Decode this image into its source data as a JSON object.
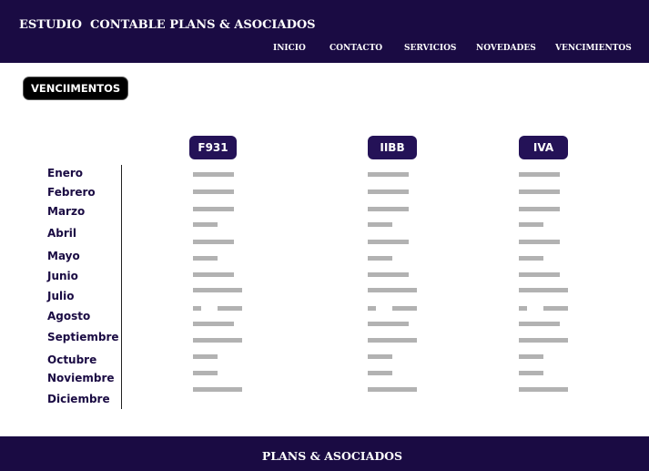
{
  "header": {
    "brand": "ESTUDIO  CONTABLE PLANS & ASOCIADOS",
    "nav": [
      "INICIO",
      "CONTACTO",
      "SERVICIOS",
      "NOVEDADES",
      "VENCIMIENTOS"
    ]
  },
  "section_button": "VENCIIMENTOS",
  "columns": [
    "F931",
    "IIBB",
    "IVA"
  ],
  "months": [
    "Enero",
    "Febrero",
    "Marzo",
    "Abril",
    "Mayo",
    "Junio",
    "Julio",
    "Agosto",
    "Septiembre",
    "Octubre",
    "Noviembre",
    "Diciembre"
  ],
  "footer": {
    "text": "PLANS & ASOCIADOS"
  },
  "colors": {
    "header_bg": "#1a0b43",
    "column_header_bg": "#241257",
    "placeholder_bar": "#b2b2b2",
    "button_bg": "#000000",
    "text_dark": "#1a0b43"
  }
}
